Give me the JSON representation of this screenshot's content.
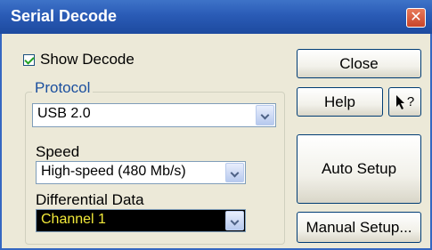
{
  "window": {
    "title": "Serial Decode",
    "close_glyph": "✕"
  },
  "show_decode": {
    "label": "Show Decode",
    "checked": true
  },
  "protocol": {
    "legend": "Protocol",
    "selected": "USB 2.0"
  },
  "speed": {
    "label": "Speed",
    "selected": "High-speed (480 Mb/s)"
  },
  "differential_data": {
    "label": "Differential Data",
    "selected": "Channel 1"
  },
  "buttons": {
    "close": "Close",
    "help": "Help",
    "help_arrow": "?",
    "auto_setup": "Auto Setup",
    "manual_setup": "Manual Setup..."
  },
  "colors": {
    "title_bar": "#2a5bb6",
    "dialog_bg": "#ece9d8",
    "legend_text": "#1b4f9e",
    "channel_bg": "#000000",
    "channel_text": "#f2e93a"
  }
}
